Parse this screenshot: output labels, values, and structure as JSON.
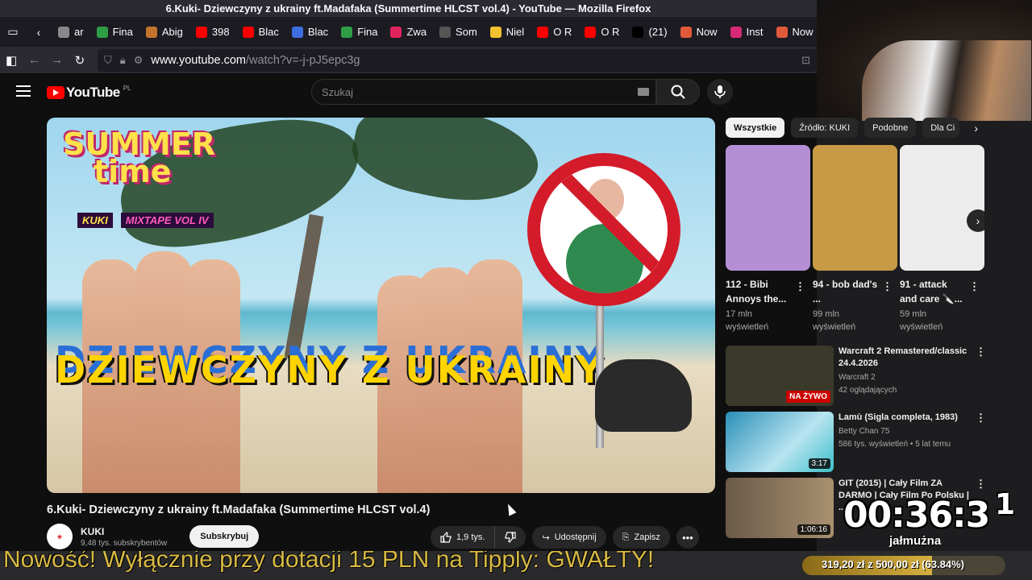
{
  "window": {
    "title": "6.Kuki- Dziewczyny z ukrainy ft.Madafaka (Summertime HLCST vol.4) - YouTube — Mozilla Firefox"
  },
  "tabs": [
    {
      "label": "ar",
      "color": "#888888"
    },
    {
      "label": "Fina",
      "color": "#2e9d46"
    },
    {
      "label": "Abig",
      "color": "#c2742e"
    },
    {
      "label": "398",
      "color": "#ff0000"
    },
    {
      "label": "Blac",
      "color": "#ff0000"
    },
    {
      "label": "Blac",
      "color": "#3d6ee0"
    },
    {
      "label": "Fina",
      "color": "#2e9d46"
    },
    {
      "label": "Zwa",
      "color": "#e0245e"
    },
    {
      "label": "Som",
      "color": "#555555"
    },
    {
      "label": "Niel",
      "color": "#f2c12e"
    },
    {
      "label": "O R",
      "color": "#ff0000"
    },
    {
      "label": "O R",
      "color": "#ff0000"
    },
    {
      "label": "(21)",
      "color": "#000000"
    },
    {
      "label": "Now",
      "color": "#e05a3a"
    },
    {
      "label": "Inst",
      "color": "#d62976"
    },
    {
      "label": "Now",
      "color": "#e05a3a"
    }
  ],
  "nav": {
    "url_domain": "www.youtube.com",
    "url_path": "/watch?v=-j-pJ5epc3g"
  },
  "youtube": {
    "logo": "YouTube",
    "region": "PL",
    "search_placeholder": "Szukaj"
  },
  "thumbnail": {
    "summer": "SUMMER",
    "time": "time",
    "kuki": "KUKI",
    "mixtape": "MIXTAPE VOL IV",
    "big_title": "DZIEWCZYNY Z UKRAINY"
  },
  "video": {
    "title": "6.Kuki- Dziewczyny z ukrainy ft.Madafaka (Summertime HLCST vol.4)",
    "channel": "KUKI",
    "subscribers": "9,48 tys. subskrybentów",
    "subscribe": "Subskrybuj",
    "likes": "1,9 tys.",
    "share": "Udostępnij",
    "save": "Zapisz"
  },
  "chips": [
    "Wszystkie",
    "Źródło: KUKI",
    "Podobne",
    "Dla Ci"
  ],
  "shorts": [
    {
      "title": "112 - Bibi Annoys the...",
      "views": "17 mln wyświetleń",
      "bg": "#b48fd6"
    },
    {
      "title": "94 - bob dad's ...",
      "views": "99 mln wyświetleń",
      "bg": "#c99a45"
    },
    {
      "title": "91 - attack and care 🔪...",
      "views": "59 mln wyświetleń",
      "bg": "#ececec"
    }
  ],
  "recommended": [
    {
      "title": "Warcraft 2 Remastered/classic 24.4.2026",
      "channel": "Warcraft 2",
      "meta": "42 oglądających",
      "badge": "NA ŻYWO",
      "bg": "#3b3a2a"
    },
    {
      "title": "Lamù (Sigla completa, 1983)",
      "channel": "Betty Chan 75",
      "meta": "586 tys. wyświetleń • 5 lat temu",
      "badge": "3:17",
      "bg": "#2a8fb8"
    },
    {
      "title": "GIT (2015) | Cały Film ZA DARMO | Cały Film Po Polsku | ...",
      "channel": "",
      "meta": "",
      "badge": "1:06:16",
      "bg": "#6b5a48"
    }
  ],
  "overlay": {
    "timer": "00:36:3",
    "timer_digit": "1",
    "alms_label": "jałmużna",
    "ticker": "Nowość! Wyłącznie przy dotacji 15 PLN na Tipply: GWAŁTY!",
    "donation_text": "319,20 zł z 500,00 zł (63.84%)",
    "donation_progress": 0.6384
  },
  "colors": {
    "yt_bg": "#0f0f0f",
    "firefox_bar": "#2b2a33",
    "accent_red": "#ff0000"
  }
}
